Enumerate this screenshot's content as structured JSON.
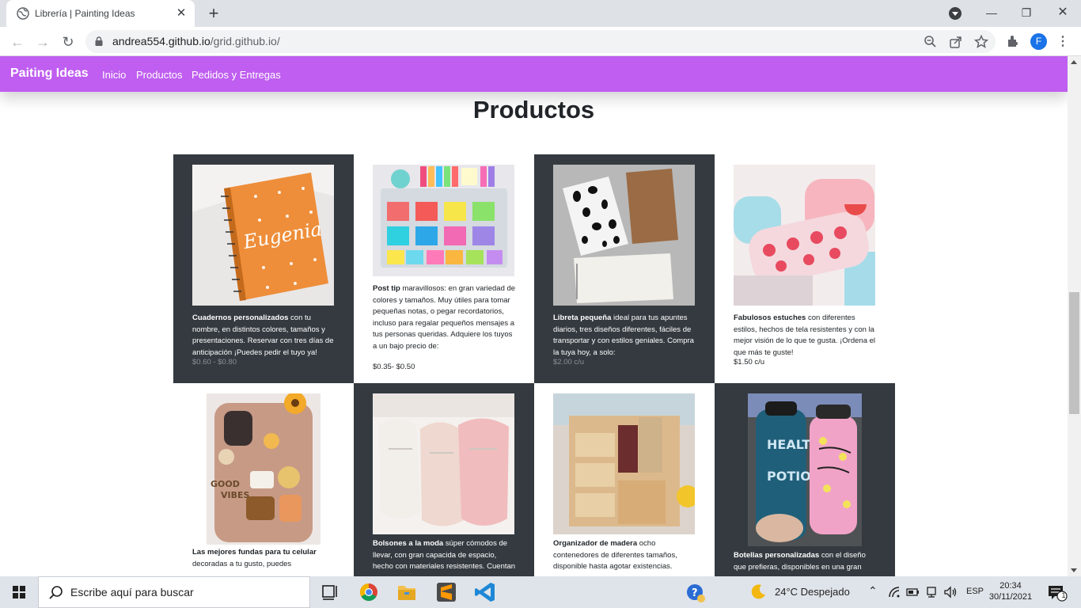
{
  "browser": {
    "tab_title": "Librería | Painting Ideas",
    "url_host": "andrea554.github.io",
    "url_path": "/grid.github.io/",
    "profile_initial": "F"
  },
  "site": {
    "brand": "Paiting Ideas",
    "nav": [
      "Inicio",
      "Productos",
      "Pedidos y Entregas"
    ],
    "heading": "Productos",
    "accent_color": "#bf5ef0"
  },
  "products": [
    {
      "name": "Cuadernos personalizados",
      "text": " con tu nombre, en distintos colores, tamaños y presentaciones. Reservar con tres días de anticipación ¡Puedes pedir el tuyo ya!",
      "price": "$0.60 - $0.80"
    },
    {
      "name": "Post tip",
      "text": " maravillosos: en gran variedad de colores y tamaños. Muy útiles para tomar pequeñas notas, o pegar recordatorios, incluso para regalar pequeños mensajes a tus personas queridas. Adquiere los tuyos a un bajo precio de:",
      "price": "$0.35- $0.50"
    },
    {
      "name": "Libreta pequeña",
      "text": " ideal para tus apuntes diarios, tres diseños diferentes, fáciles de transportar y con estilos geniales. Compra la tuya hoy, a solo:",
      "price": "$2.00 c/u"
    },
    {
      "name": "Fabulosos estuches",
      "text": " con diferentes estilos, hechos de tela resistentes y con la mejor visión de lo que te gusta. ¡Ordena el que más te guste!",
      "price": "$1.50 c/u"
    },
    {
      "name": "Las mejores fundas para tu celular",
      "text": " decoradas a tu gusto, puedes",
      "price": ""
    },
    {
      "name": "Bolsones a la moda",
      "text": " súper cómodos de llevar, con gran capacida de espacio, hecho con materiales resistentes. Cuentan",
      "price": ""
    },
    {
      "name": "Organizador de madera",
      "text": " ocho contenedores de diferentes tamaños, disponible hasta agotar existencias.",
      "price": ""
    },
    {
      "name": "Botellas personalizadas",
      "text": " con el diseño que prefieras, disponibles en una gran",
      "price": ""
    }
  ],
  "taskbar": {
    "search_placeholder": "Escribe aquí para buscar",
    "weather": "24°C  Despejado",
    "language": "ESP",
    "time": "20:34",
    "date": "30/11/2021",
    "notification_count": "1"
  }
}
